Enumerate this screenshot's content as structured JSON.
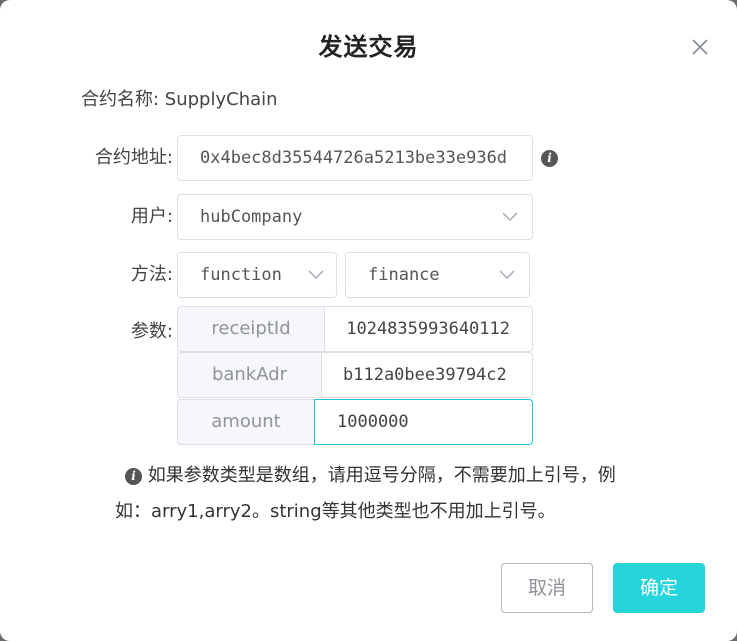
{
  "dialog": {
    "title": "发送交易",
    "close_icon": "close-icon"
  },
  "contract": {
    "name_label": "合约名称: SupplyChain",
    "address_label": "合约地址:",
    "address_value": "0x4bec8d35544726a5213be33e936d",
    "address_info_icon": "info-icon"
  },
  "user": {
    "label": "用户:",
    "value": "hubCompany"
  },
  "method": {
    "label": "方法:",
    "type_value": "function",
    "name_value": "finance"
  },
  "params": {
    "label": "参数:",
    "rows": [
      {
        "key": "receiptId",
        "value": "1024835993640112"
      },
      {
        "key": "bankAdr",
        "value": "b112a0bee39794c2"
      },
      {
        "key": "amount",
        "value": "1000000"
      }
    ]
  },
  "hint": {
    "icon": "info-icon",
    "line1": "如果参数类型是数组，请用逗号分隔，不需要加上引号，例",
    "line2": "如：arry1,arry2。string等其他类型也不用加上引号。"
  },
  "buttons": {
    "cancel": "取消",
    "confirm": "确定"
  },
  "colors": {
    "accent": "#26d4dc",
    "border": "#dcdfe6",
    "param_key_bg": "#f5f7fa"
  }
}
